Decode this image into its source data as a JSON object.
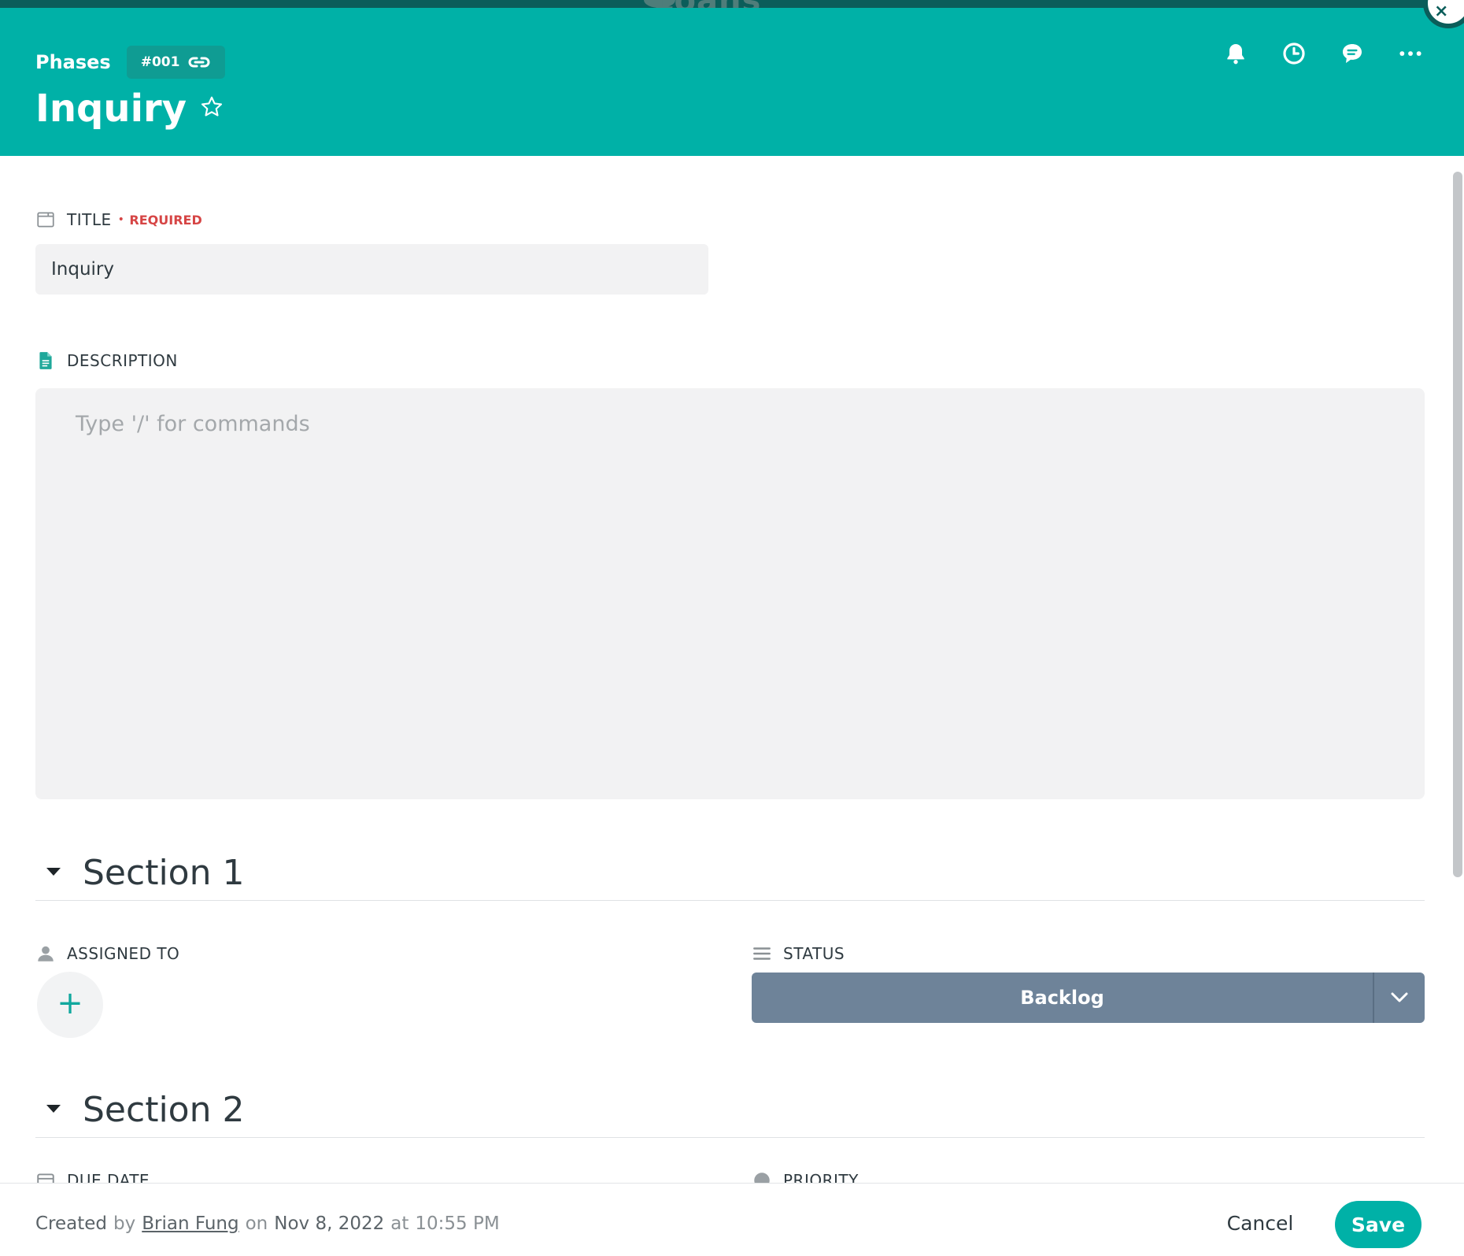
{
  "colors": {
    "brand": "#00b1a7",
    "required": "#d64545",
    "status_backlog": "#6e8399"
  },
  "background": {
    "app_title_partial": "Loans"
  },
  "header": {
    "breadcrumb": "Phases",
    "record_id": "#001",
    "title": "Inquiry",
    "icons": [
      "bell-icon",
      "clock-icon",
      "comment-icon",
      "more-icon"
    ]
  },
  "fields": {
    "title": {
      "label": "TITLE",
      "required_label": "REQUIRED",
      "value": "Inquiry"
    },
    "description": {
      "label": "DESCRIPTION",
      "placeholder": "Type '/' for commands"
    }
  },
  "sections": [
    {
      "title": "Section 1",
      "fields": {
        "assigned_to_label": "ASSIGNED TO",
        "status_label": "STATUS",
        "status_value": "Backlog"
      }
    },
    {
      "title": "Section 2",
      "fields": {
        "due_date_label": "DUE DATE",
        "priority_label": "PRIORITY"
      }
    }
  ],
  "footer": {
    "created_word": "Created",
    "by_word": "by",
    "user": "Brian Fung",
    "on_word": "on",
    "date": "Nov 8, 2022",
    "at_word": "at",
    "time": "10:55 PM",
    "cancel_label": "Cancel",
    "save_label": "Save"
  }
}
